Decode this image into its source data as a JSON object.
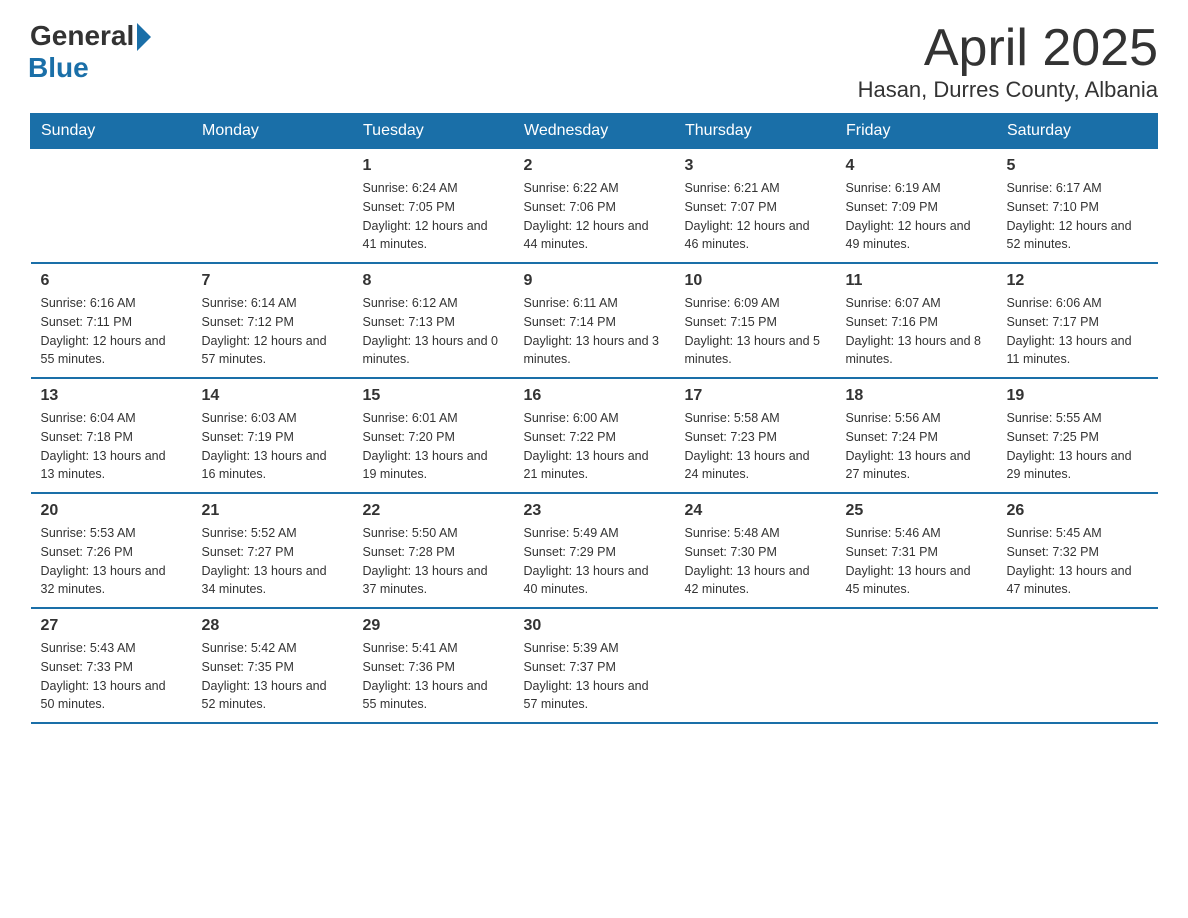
{
  "header": {
    "logo_general": "General",
    "logo_blue": "Blue",
    "month_title": "April 2025",
    "location": "Hasan, Durres County, Albania"
  },
  "days_of_week": [
    "Sunday",
    "Monday",
    "Tuesday",
    "Wednesday",
    "Thursday",
    "Friday",
    "Saturday"
  ],
  "weeks": [
    [
      {
        "day": "",
        "sunrise": "",
        "sunset": "",
        "daylight": ""
      },
      {
        "day": "",
        "sunrise": "",
        "sunset": "",
        "daylight": ""
      },
      {
        "day": "1",
        "sunrise": "Sunrise: 6:24 AM",
        "sunset": "Sunset: 7:05 PM",
        "daylight": "Daylight: 12 hours and 41 minutes."
      },
      {
        "day": "2",
        "sunrise": "Sunrise: 6:22 AM",
        "sunset": "Sunset: 7:06 PM",
        "daylight": "Daylight: 12 hours and 44 minutes."
      },
      {
        "day": "3",
        "sunrise": "Sunrise: 6:21 AM",
        "sunset": "Sunset: 7:07 PM",
        "daylight": "Daylight: 12 hours and 46 minutes."
      },
      {
        "day": "4",
        "sunrise": "Sunrise: 6:19 AM",
        "sunset": "Sunset: 7:09 PM",
        "daylight": "Daylight: 12 hours and 49 minutes."
      },
      {
        "day": "5",
        "sunrise": "Sunrise: 6:17 AM",
        "sunset": "Sunset: 7:10 PM",
        "daylight": "Daylight: 12 hours and 52 minutes."
      }
    ],
    [
      {
        "day": "6",
        "sunrise": "Sunrise: 6:16 AM",
        "sunset": "Sunset: 7:11 PM",
        "daylight": "Daylight: 12 hours and 55 minutes."
      },
      {
        "day": "7",
        "sunrise": "Sunrise: 6:14 AM",
        "sunset": "Sunset: 7:12 PM",
        "daylight": "Daylight: 12 hours and 57 minutes."
      },
      {
        "day": "8",
        "sunrise": "Sunrise: 6:12 AM",
        "sunset": "Sunset: 7:13 PM",
        "daylight": "Daylight: 13 hours and 0 minutes."
      },
      {
        "day": "9",
        "sunrise": "Sunrise: 6:11 AM",
        "sunset": "Sunset: 7:14 PM",
        "daylight": "Daylight: 13 hours and 3 minutes."
      },
      {
        "day": "10",
        "sunrise": "Sunrise: 6:09 AM",
        "sunset": "Sunset: 7:15 PM",
        "daylight": "Daylight: 13 hours and 5 minutes."
      },
      {
        "day": "11",
        "sunrise": "Sunrise: 6:07 AM",
        "sunset": "Sunset: 7:16 PM",
        "daylight": "Daylight: 13 hours and 8 minutes."
      },
      {
        "day": "12",
        "sunrise": "Sunrise: 6:06 AM",
        "sunset": "Sunset: 7:17 PM",
        "daylight": "Daylight: 13 hours and 11 minutes."
      }
    ],
    [
      {
        "day": "13",
        "sunrise": "Sunrise: 6:04 AM",
        "sunset": "Sunset: 7:18 PM",
        "daylight": "Daylight: 13 hours and 13 minutes."
      },
      {
        "day": "14",
        "sunrise": "Sunrise: 6:03 AM",
        "sunset": "Sunset: 7:19 PM",
        "daylight": "Daylight: 13 hours and 16 minutes."
      },
      {
        "day": "15",
        "sunrise": "Sunrise: 6:01 AM",
        "sunset": "Sunset: 7:20 PM",
        "daylight": "Daylight: 13 hours and 19 minutes."
      },
      {
        "day": "16",
        "sunrise": "Sunrise: 6:00 AM",
        "sunset": "Sunset: 7:22 PM",
        "daylight": "Daylight: 13 hours and 21 minutes."
      },
      {
        "day": "17",
        "sunrise": "Sunrise: 5:58 AM",
        "sunset": "Sunset: 7:23 PM",
        "daylight": "Daylight: 13 hours and 24 minutes."
      },
      {
        "day": "18",
        "sunrise": "Sunrise: 5:56 AM",
        "sunset": "Sunset: 7:24 PM",
        "daylight": "Daylight: 13 hours and 27 minutes."
      },
      {
        "day": "19",
        "sunrise": "Sunrise: 5:55 AM",
        "sunset": "Sunset: 7:25 PM",
        "daylight": "Daylight: 13 hours and 29 minutes."
      }
    ],
    [
      {
        "day": "20",
        "sunrise": "Sunrise: 5:53 AM",
        "sunset": "Sunset: 7:26 PM",
        "daylight": "Daylight: 13 hours and 32 minutes."
      },
      {
        "day": "21",
        "sunrise": "Sunrise: 5:52 AM",
        "sunset": "Sunset: 7:27 PM",
        "daylight": "Daylight: 13 hours and 34 minutes."
      },
      {
        "day": "22",
        "sunrise": "Sunrise: 5:50 AM",
        "sunset": "Sunset: 7:28 PM",
        "daylight": "Daylight: 13 hours and 37 minutes."
      },
      {
        "day": "23",
        "sunrise": "Sunrise: 5:49 AM",
        "sunset": "Sunset: 7:29 PM",
        "daylight": "Daylight: 13 hours and 40 minutes."
      },
      {
        "day": "24",
        "sunrise": "Sunrise: 5:48 AM",
        "sunset": "Sunset: 7:30 PM",
        "daylight": "Daylight: 13 hours and 42 minutes."
      },
      {
        "day": "25",
        "sunrise": "Sunrise: 5:46 AM",
        "sunset": "Sunset: 7:31 PM",
        "daylight": "Daylight: 13 hours and 45 minutes."
      },
      {
        "day": "26",
        "sunrise": "Sunrise: 5:45 AM",
        "sunset": "Sunset: 7:32 PM",
        "daylight": "Daylight: 13 hours and 47 minutes."
      }
    ],
    [
      {
        "day": "27",
        "sunrise": "Sunrise: 5:43 AM",
        "sunset": "Sunset: 7:33 PM",
        "daylight": "Daylight: 13 hours and 50 minutes."
      },
      {
        "day": "28",
        "sunrise": "Sunrise: 5:42 AM",
        "sunset": "Sunset: 7:35 PM",
        "daylight": "Daylight: 13 hours and 52 minutes."
      },
      {
        "day": "29",
        "sunrise": "Sunrise: 5:41 AM",
        "sunset": "Sunset: 7:36 PM",
        "daylight": "Daylight: 13 hours and 55 minutes."
      },
      {
        "day": "30",
        "sunrise": "Sunrise: 5:39 AM",
        "sunset": "Sunset: 7:37 PM",
        "daylight": "Daylight: 13 hours and 57 minutes."
      },
      {
        "day": "",
        "sunrise": "",
        "sunset": "",
        "daylight": ""
      },
      {
        "day": "",
        "sunrise": "",
        "sunset": "",
        "daylight": ""
      },
      {
        "day": "",
        "sunrise": "",
        "sunset": "",
        "daylight": ""
      }
    ]
  ]
}
